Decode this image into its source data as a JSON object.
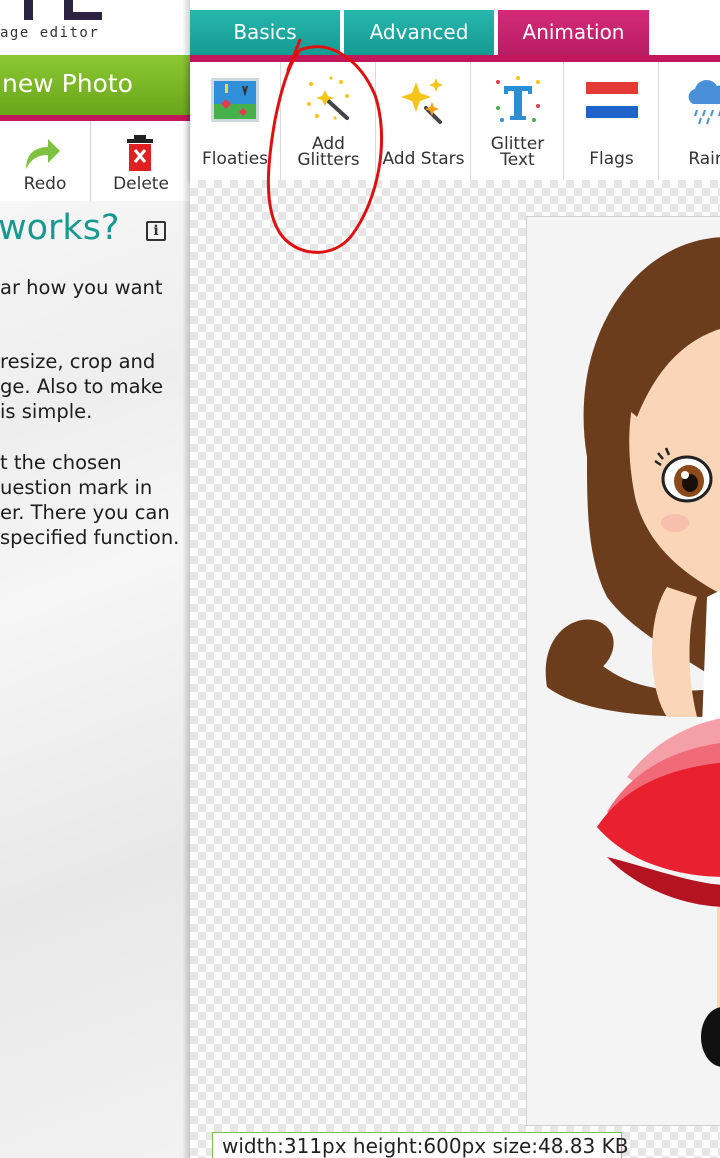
{
  "app": {
    "logo_subtitle": "age editor"
  },
  "sidebar": {
    "new_photo_label": "new Photo",
    "tools": [
      {
        "label": "Redo",
        "icon": "redo-arrow-icon"
      },
      {
        "label": "Delete",
        "icon": "trash-icon"
      }
    ],
    "help": {
      "title": "works?",
      "info_icon": "i",
      "paragraphs": [
        [
          "ar how you want"
        ],
        [
          "resize, crop and",
          "ge. Also to make",
          "is simple."
        ],
        [
          "t the chosen",
          "uestion mark in",
          "er. There you can",
          "specified function."
        ]
      ]
    }
  },
  "tabs": [
    {
      "label": "Basics",
      "active": false
    },
    {
      "label": "Advanced",
      "active": false
    },
    {
      "label": "Animation",
      "active": true
    }
  ],
  "effects": [
    {
      "label": "Floaties",
      "icon": "floaties-icon"
    },
    {
      "label": "Add Glitters",
      "icon": "magic-wand-glitter-icon"
    },
    {
      "label": "Add Stars",
      "icon": "stars-icon"
    },
    {
      "label": "Glitter Text",
      "icon": "glitter-text-icon"
    },
    {
      "label": "Flags",
      "icon": "flag-icon"
    },
    {
      "label": "Rain",
      "icon": "rain-cloud-icon"
    }
  ],
  "canvas": {
    "status": "width:311px  height:600px  size:48.83 KB"
  },
  "colors": {
    "teal_tab": "#1aa69d",
    "magenta_tab": "#c2185b",
    "green_button": "#7ab82a",
    "help_title": "#17998f",
    "annotation_red": "#e01010"
  }
}
